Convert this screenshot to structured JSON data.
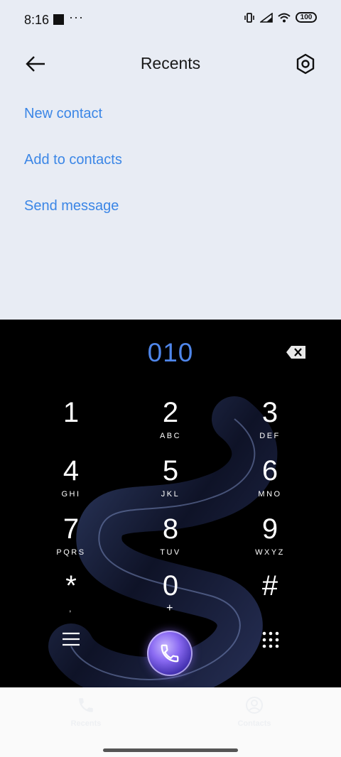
{
  "status_bar": {
    "time": "8:16",
    "dots": "···",
    "battery": "100"
  },
  "header": {
    "title": "Recents",
    "back_icon": "arrow-left-icon",
    "settings_icon": "hexagon-gear-icon"
  },
  "actions": [
    "New contact",
    "Add to contacts",
    "Send message"
  ],
  "dialer": {
    "number": "010",
    "keys": [
      {
        "digit": "1",
        "letters": ""
      },
      {
        "digit": "2",
        "letters": "ABC"
      },
      {
        "digit": "3",
        "letters": "DEF"
      },
      {
        "digit": "4",
        "letters": "GHI"
      },
      {
        "digit": "5",
        "letters": "JKL"
      },
      {
        "digit": "6",
        "letters": "MNO"
      },
      {
        "digit": "7",
        "letters": "PQRS"
      },
      {
        "digit": "8",
        "letters": "TUV"
      },
      {
        "digit": "9",
        "letters": "WXYZ"
      },
      {
        "digit": "*",
        "letters": ","
      },
      {
        "digit": "0",
        "letters": "+"
      },
      {
        "digit": "#",
        "letters": ""
      }
    ]
  },
  "bottom_nav": {
    "tabs": [
      "Recents",
      "Contacts"
    ]
  },
  "colors": {
    "accent": "#3b86e6",
    "number": "#4f86ea",
    "dialer_bg": "#000000",
    "top_bg": "#e8ecf4"
  }
}
